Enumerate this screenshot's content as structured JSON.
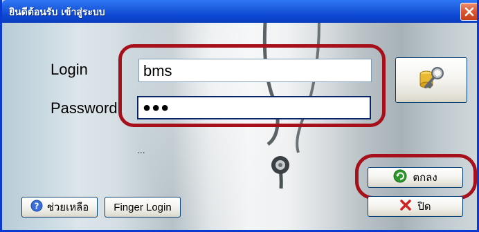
{
  "window": {
    "title": "ยินดีต้อนรับ เข้าสู่ระบบ"
  },
  "login_form": {
    "login_label": "Login",
    "login_value": "bms",
    "password_label": "Password",
    "password_masked": "●●●"
  },
  "status_text": "...",
  "buttons": {
    "ok_label": "ตกลง",
    "close_label": "ปิด",
    "help_label": "ช่วยเหลือ",
    "finger_login_label": "Finger Login"
  },
  "colors": {
    "titlebar": "#0c47d3",
    "highlight_ring": "#a5101a",
    "ok_icon": "#2e9a2e",
    "close_icon": "#d02020",
    "help_icon": "#3a6fd8"
  },
  "icons": [
    "close-icon",
    "key-database-icon",
    "ok-check-icon",
    "cancel-x-icon",
    "help-question-icon"
  ]
}
